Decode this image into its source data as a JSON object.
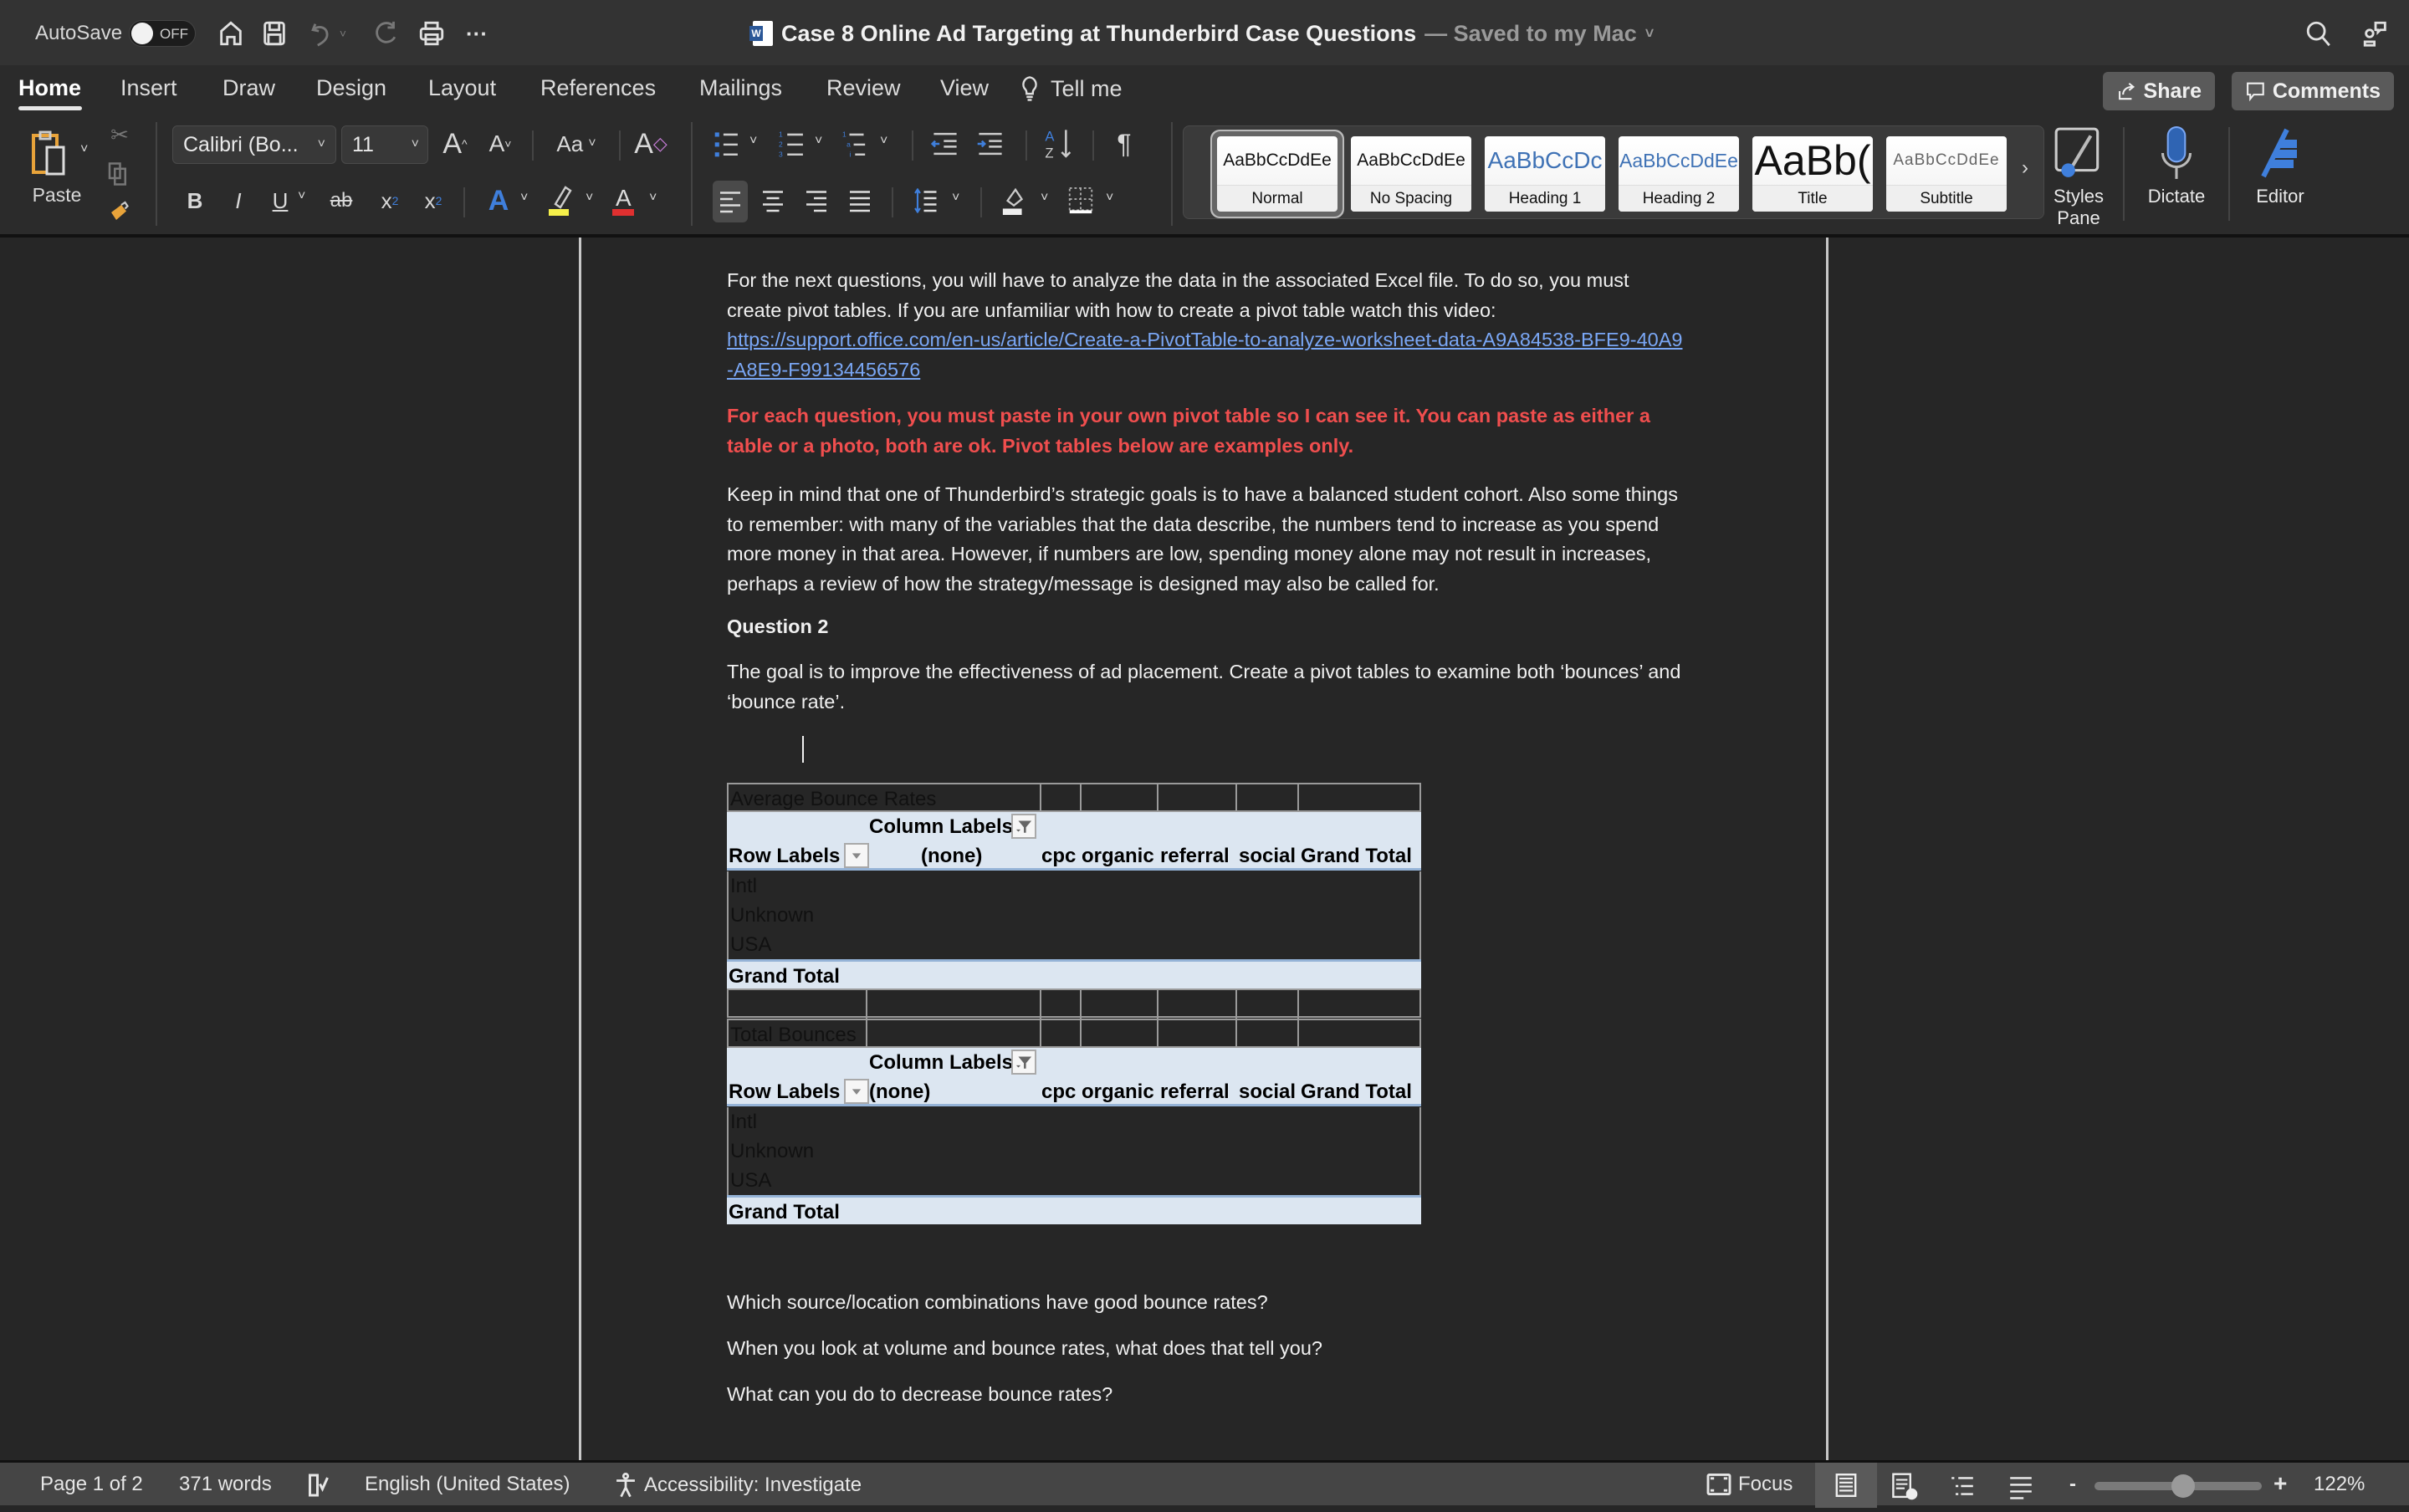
{
  "titlebar": {
    "autosave_label": "AutoSave",
    "autosave_state": "OFF",
    "doc_title": "Case 8 Online Ad Targeting at Thunderbird Case Questions",
    "save_status": "— Saved to my Mac",
    "icons": [
      "home-icon",
      "save-icon",
      "undo-icon",
      "redo-icon",
      "print-icon",
      "more-icon",
      "search-icon",
      "share-people-icon"
    ]
  },
  "tabs": {
    "items": [
      "Home",
      "Insert",
      "Draw",
      "Design",
      "Layout",
      "References",
      "Mailings",
      "Review",
      "View"
    ],
    "active": "Home",
    "tell_me": "Tell me",
    "share_label": "Share",
    "comments_label": "Comments"
  },
  "ribbon": {
    "paste_label": "Paste",
    "font_name": "Calibri (Bo...",
    "font_size": "11",
    "change_case_label": "Aa",
    "styles": [
      {
        "sample": "AaBbCcDdEe",
        "label": "Normal",
        "selected": true
      },
      {
        "sample": "AaBbCcDdEe",
        "label": "No Spacing"
      },
      {
        "sample": "AaBbCcDc",
        "label": "Heading 1"
      },
      {
        "sample": "AaBbCcDdEe",
        "label": "Heading 2"
      },
      {
        "sample": "AaBb(",
        "label": "Title"
      },
      {
        "sample": "AaBbCcDdEe",
        "label": "Subtitle"
      }
    ],
    "styles_pane_label_1": "Styles",
    "styles_pane_label_2": "Pane",
    "dictate_label": "Dictate",
    "editor_label": "Editor",
    "colors": {
      "highlight": "#f5f04a",
      "font_color": "#e03030",
      "accent_blue": "#3f7fdc"
    }
  },
  "document": {
    "para1": "For the next questions, you will have to analyze the data in the associated Excel file. To do so, you must create pivot tables. If you are unfamiliar with how to create a pivot table watch this video:",
    "link": "https://support.office.com/en-us/article/Create-a-PivotTable-to-analyze-worksheet-data-A9A84538-BFE9-40A9-A8E9-F99134456576",
    "red_note": "For each question, you must paste in your own pivot table so I can see it. You can paste as either a table or a photo, both are ok. Pivot tables below are examples only.",
    "para2": "Keep in mind that one of Thunderbird’s strategic goals is to have a balanced student cohort. Also some things to remember: with many of the variables that the data describe, the numbers tend to increase as you spend more money in that area. However, if numbers are low, spending money alone may not result in increases, perhaps a review of how the strategy/message is designed may also be called for.",
    "question_heading": "Question 2",
    "question_text": "The goal is to improve the effectiveness of ad placement. Create a pivot tables to examine both ‘bounces’ and ‘bounce rate’.",
    "pivot_tables": [
      {
        "title": "Average Bounce Rates",
        "column_labels": "Column Labels",
        "row_labels": "Row Labels",
        "columns": [
          "(none)",
          "cpc",
          "organic",
          "referral",
          "social",
          "Grand Total"
        ],
        "rows": [
          "Intl",
          "Unknown",
          "USA"
        ],
        "grand_total": "Grand Total"
      },
      {
        "title": "Total Bounces",
        "column_labels": "Column Labels",
        "row_labels": "Row Labels",
        "columns": [
          "(none)",
          "cpc",
          "organic",
          "referral",
          "social",
          "Grand Total"
        ],
        "rows": [
          "Intl",
          "Unknown",
          "USA"
        ],
        "grand_total": "Grand Total"
      }
    ],
    "questions": [
      "Which source/location combinations have good bounce rates?",
      "When you look at volume and bounce rates, what does that tell you?",
      "What can you do to decrease bounce rates?"
    ]
  },
  "statusbar": {
    "page": "Page 1 of 2",
    "words": "371 words",
    "language": "English (United States)",
    "accessibility": "Accessibility: Investigate",
    "focus": "Focus",
    "zoom_minus": "-",
    "zoom_plus": "+",
    "zoom_level": "122%",
    "zoom_percent": 122
  }
}
